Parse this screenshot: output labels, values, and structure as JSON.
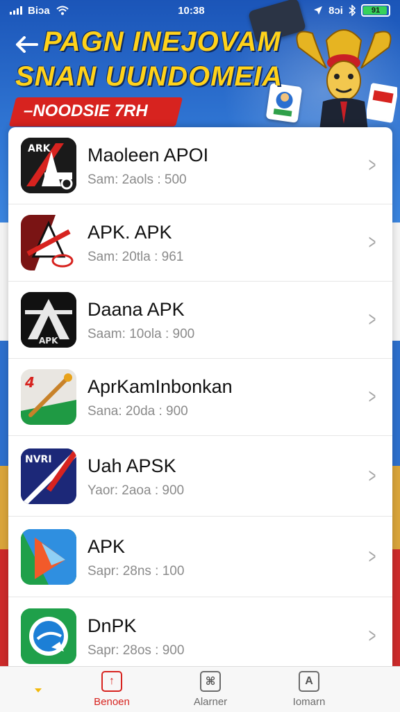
{
  "status_bar": {
    "carrier": "Biɔa",
    "time": "10:38",
    "network": "8ɔi",
    "battery_label": "91",
    "battery_level": 0.9
  },
  "header": {
    "back_icon": "back-arrow-icon",
    "headline_line1": "PAGN INEJOVAM",
    "headline_line2": "SNAN UUNDOMEIA",
    "promo": "–NOODSIE 7RH"
  },
  "apps": [
    {
      "name": "Maoleen APOI",
      "meta": "Sam: 2aols : 500",
      "icon": "apk-red-black-icon"
    },
    {
      "name": "APK. APK",
      "meta": "Sam: 20tla : 961",
      "icon": "apk-red-white-icon"
    },
    {
      "name": "Daana APK",
      "meta": "Saam: 10ola : 900",
      "icon": "apk-black-icon"
    },
    {
      "name": "AprKamInbonkan",
      "meta": "Sana: 20da : 900",
      "icon": "apk-flag-icon"
    },
    {
      "name": "Uah APSK",
      "meta": "Yaor: 2aoa : 900",
      "icon": "apk-navy-icon"
    },
    {
      "name": "APK",
      "meta": "Sapr: 28ns : 100",
      "icon": "apk-play-icon"
    },
    {
      "name": "DnPK",
      "meta": "Sapr: 28os : 900",
      "icon": "apk-globe-icon"
    }
  ],
  "tabs": [
    {
      "label": "Benoen",
      "icon": "upload-icon",
      "glyph": "↑",
      "active": true
    },
    {
      "label": "Alarner",
      "icon": "image-icon",
      "glyph": "⌘",
      "active": false
    },
    {
      "label": "Iomarn",
      "icon": "app-store-icon",
      "glyph": "A",
      "active": false
    }
  ],
  "colors": {
    "accent": "#d7231f",
    "headline": "#ffd21a",
    "hero_blue": "#2f74d2"
  }
}
